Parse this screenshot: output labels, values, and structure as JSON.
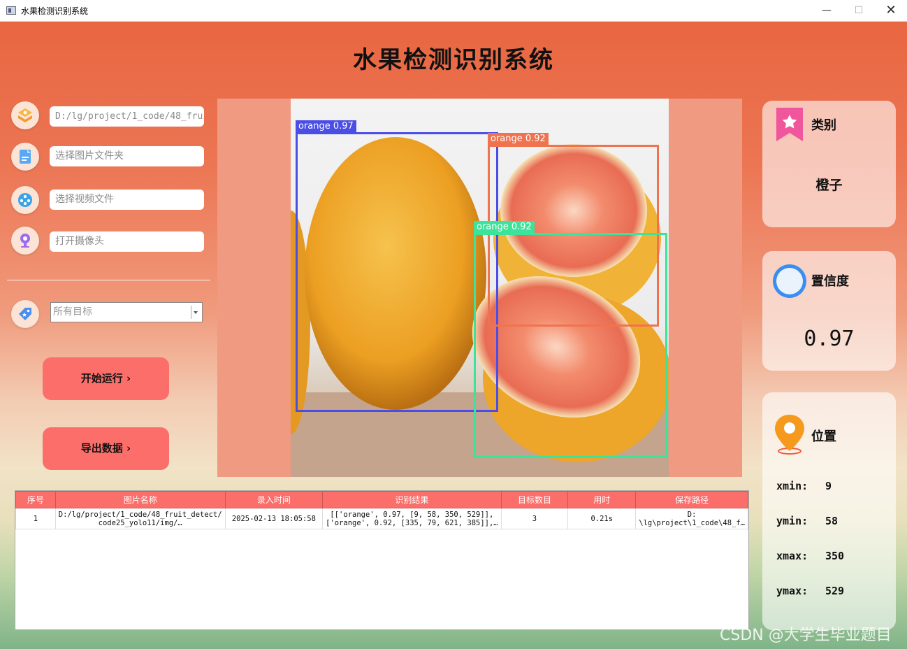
{
  "window": {
    "title": "水果检测识别系统",
    "min": "—",
    "max": "☐",
    "close": "✕"
  },
  "app_title": "水果检测识别系统",
  "left_panel": {
    "image_path": "D:/lg/project/1_code/48_fruit",
    "folder_placeholder": "选择图片文件夹",
    "video_placeholder": "选择视频文件",
    "camera_placeholder": "打开摄像头",
    "target_select": "所有目标",
    "start_button": "开始运行 ›",
    "export_button": "导出数据 ›"
  },
  "detections": [
    {
      "label": "orange 0.97",
      "color": "#4a4ee6"
    },
    {
      "label": "orange 0.92",
      "color": "#f0734f"
    },
    {
      "label": "orange 0.92",
      "color": "#3de39a"
    }
  ],
  "right_panel": {
    "class_title": "类别",
    "class_value": "橙子",
    "conf_title": "置信度",
    "conf_value": "0.97",
    "pos_title": "位置",
    "xmin_label": "xmin:",
    "xmin": "9",
    "ymin_label": "ymin:",
    "ymin": "58",
    "xmax_label": "xmax:",
    "xmax": "350",
    "ymax_label": "ymax:",
    "ymax": "529"
  },
  "table": {
    "headers": [
      "序号",
      "图片名称",
      "录入时间",
      "识别结果",
      "目标数目",
      "用时",
      "保存路径"
    ],
    "rows": [
      {
        "index": "1",
        "name_line1": "D:/lg/project/1_code/48_fruit_detect/",
        "name_line2": "code25_yolo11/img/…",
        "time": "2025-02-13 18:05:58",
        "result_line1": "[['orange', 0.97, [9, 58, 350, 529]],",
        "result_line2": "['orange', 0.92, [335, 79, 621, 385]],…",
        "count": "3",
        "duration": "0.21s",
        "path_line1": "D:",
        "path_line2": "\\lg\\project\\1_code\\48_f…"
      }
    ]
  },
  "watermark": "CSDN @大学生毕业题目"
}
